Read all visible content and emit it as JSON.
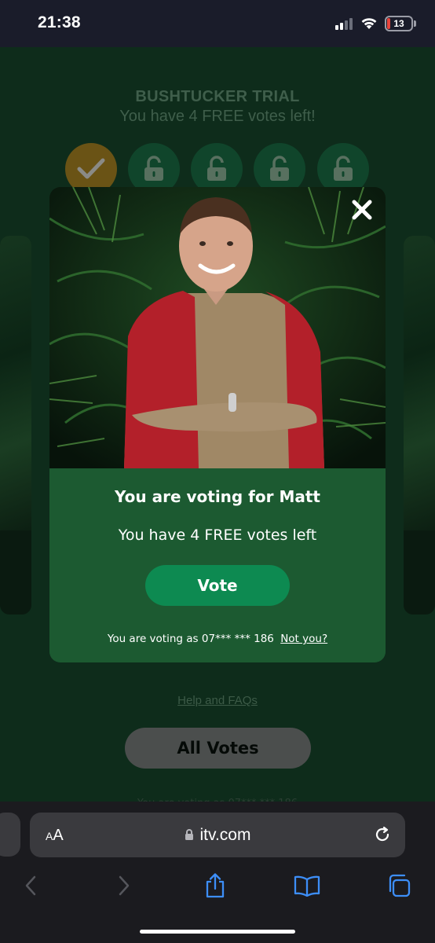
{
  "status_bar": {
    "time": "21:38",
    "battery_level": "13",
    "signal_bars_active": 2,
    "signal_bars_total": 4
  },
  "page": {
    "trial_title": "BUSHTUCKER TRIAL",
    "votes_subtitle": "You have 4 FREE votes left!",
    "vote_slots": [
      {
        "state": "used",
        "icon": "check-icon"
      },
      {
        "state": "available",
        "icon": "unlock-icon"
      },
      {
        "state": "available",
        "icon": "unlock-icon"
      },
      {
        "state": "available",
        "icon": "unlock-icon"
      },
      {
        "state": "available",
        "icon": "unlock-icon"
      }
    ],
    "help_link": "Help and FAQs",
    "all_votes_button": "All Votes"
  },
  "modal": {
    "heading": "You are voting for Matt",
    "votes_left": "You have 4 FREE votes left",
    "vote_button": "Vote",
    "voting_as_prefix": "You are voting as 07*** *** 186",
    "not_you_link": "Not you?",
    "close_icon": "close-icon"
  },
  "browser": {
    "aa_label": "AA",
    "url": "itv.com"
  },
  "colors": {
    "modal_bg": "#1c5a31",
    "vote_button": "#0d8a51",
    "used_vote": "#6a5315",
    "page_bg": "#0e2c1b",
    "browser_accent": "#3d8ef7"
  }
}
